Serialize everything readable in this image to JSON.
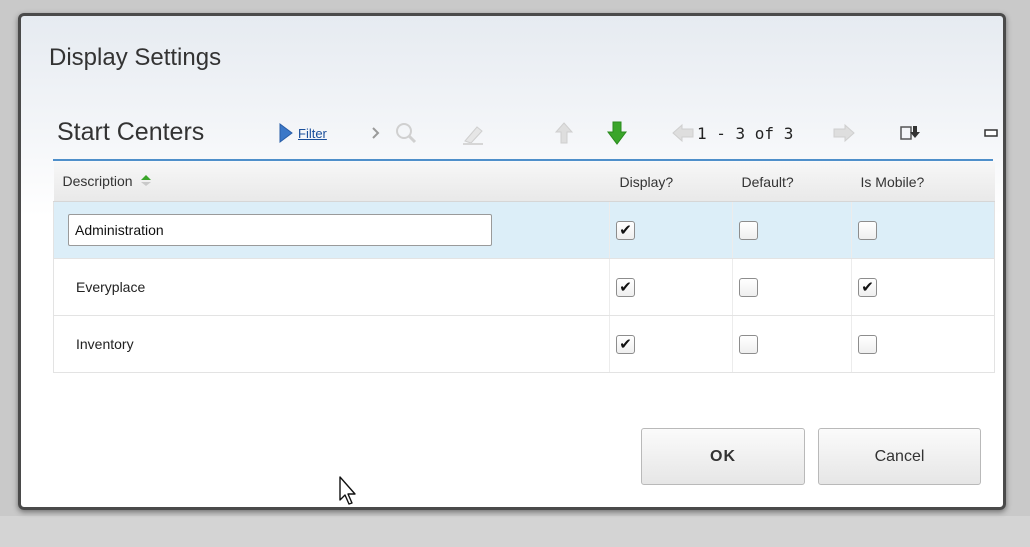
{
  "dialog": {
    "title": "Display Settings"
  },
  "section": {
    "title": "Start Centers",
    "toolbar": {
      "filter_label": "Filter",
      "pager_text": "1 - 3 of 3",
      "icons": [
        "filter-triangle-icon",
        "chevron-right-icon",
        "search-icon",
        "clear-eraser-icon",
        "arrow-up-icon",
        "arrow-down-icon",
        "prev-page-arrow-icon",
        "next-page-arrow-icon",
        "download-icon",
        "minimize-icon"
      ]
    }
  },
  "table": {
    "columns": [
      "Description",
      "Display?",
      "Default?",
      "Is Mobile?"
    ],
    "rows": [
      {
        "description": "Administration",
        "display": true,
        "default": false,
        "is_mobile": false,
        "editing": true
      },
      {
        "description": "Everyplace",
        "display": true,
        "default": false,
        "is_mobile": true,
        "editing": false
      },
      {
        "description": "Inventory",
        "display": true,
        "default": false,
        "is_mobile": false,
        "editing": false
      }
    ]
  },
  "buttons": {
    "ok_label": "OK",
    "cancel_label": "Cancel"
  },
  "colors": {
    "accent_rule": "#4e8fca",
    "selected_row": "#dceef8",
    "arrow_green": "#3aa52a",
    "filter_blue": "#3b78c8"
  }
}
